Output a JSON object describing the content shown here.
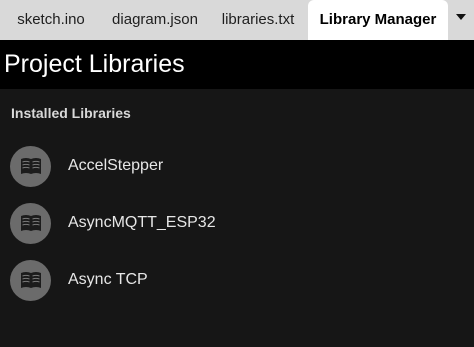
{
  "tabs": [
    {
      "label": "sketch.ino",
      "active": false
    },
    {
      "label": "diagram.json",
      "active": false
    },
    {
      "label": "libraries.txt",
      "active": false
    },
    {
      "label": "Library Manager",
      "active": true
    }
  ],
  "tab_menu_icon": "caret-down-icon",
  "header": {
    "title": "Project Libraries"
  },
  "installed": {
    "section_title": "Installed Libraries",
    "items": [
      {
        "name": "AccelStepper",
        "icon": "book-icon"
      },
      {
        "name": "AsyncMQTT_ESP32",
        "icon": "book-icon"
      },
      {
        "name": "Async TCP",
        "icon": "book-icon"
      }
    ]
  },
  "colors": {
    "background": "#161616",
    "header_bg": "#000000",
    "tabbar_bg": "#d9d9d9",
    "active_tab_bg": "#ffffff",
    "avatar_bg": "#6b6b6b"
  }
}
